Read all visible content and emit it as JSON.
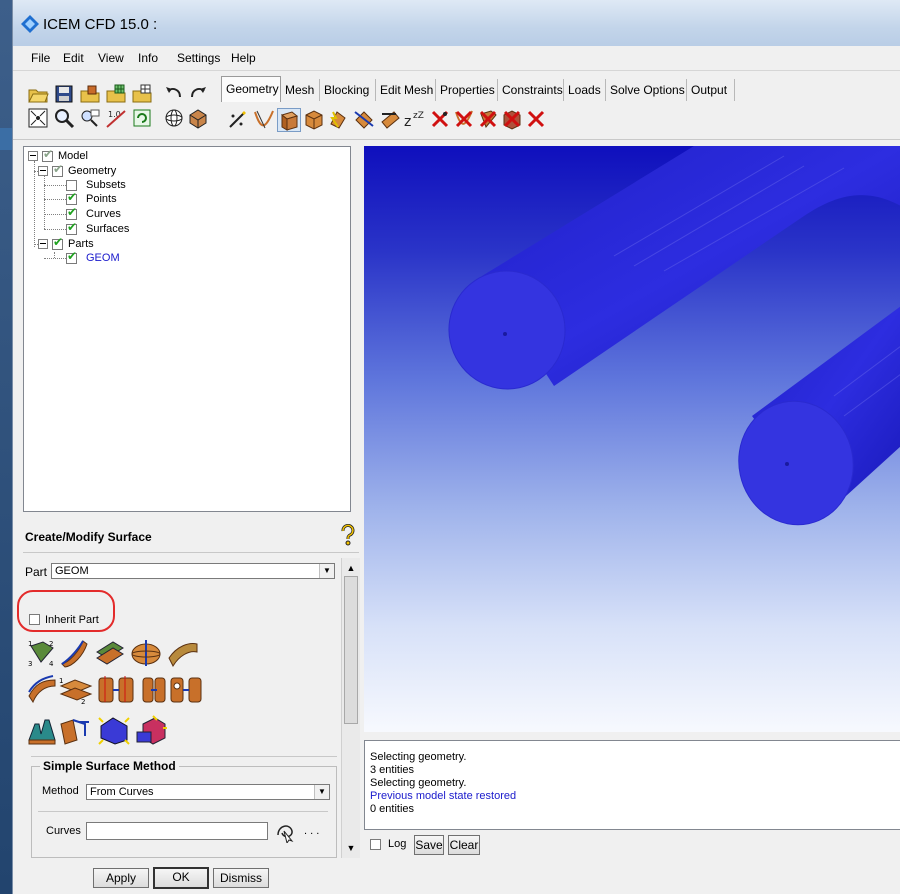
{
  "window": {
    "title": "ICEM CFD 15.0 :"
  },
  "menu": [
    "File",
    "Edit",
    "View",
    "Info",
    "Settings",
    "Help"
  ],
  "tabs": [
    "Geometry",
    "Mesh",
    "Blocking",
    "Edit Mesh",
    "Properties",
    "Constraints",
    "Loads",
    "Solve Options",
    "Output"
  ],
  "tree": {
    "model": "Model",
    "geometry": "Geometry",
    "subsets": "Subsets",
    "points": "Points",
    "curves": "Curves",
    "surfaces": "Surfaces",
    "parts": "Parts",
    "geom": "GEOM"
  },
  "panel": {
    "title": "Create/Modify Surface",
    "part_label": "Part",
    "part_value": "GEOM",
    "inherit_label": "Inherit Part",
    "group_title": "Simple Surface Method",
    "method_label": "Method",
    "method_value": "From Curves",
    "curves_label": "Curves",
    "curves_value": "",
    "dots": ". . ."
  },
  "buttons": {
    "apply": "Apply",
    "ok": "OK",
    "dismiss": "Dismiss"
  },
  "log": {
    "lines": [
      {
        "text": "Selecting geometry.",
        "color": "#000000"
      },
      {
        "text": "3 entities",
        "color": "#000000"
      },
      {
        "text": "Selecting geometry.",
        "color": "#000000"
      },
      {
        "text": "Previous model state restored",
        "color": "#1a1acc"
      },
      {
        "text": "0 entities",
        "color": "#000000"
      }
    ],
    "log_label": "Log",
    "save_label": "Save",
    "clear_label": "Clear"
  },
  "colors": {
    "geom_label": "#1a1acc",
    "tube": "#2b2bd6",
    "annotation": "#e32b2b"
  }
}
